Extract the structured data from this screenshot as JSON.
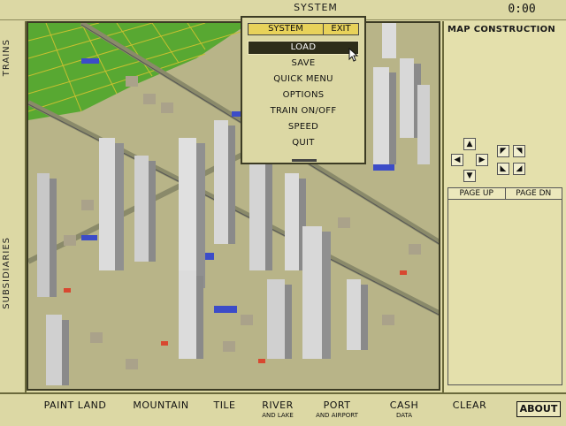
{
  "header": {
    "system_tab": "SYSTEM",
    "clock": "0:00"
  },
  "left_rail": {
    "tabs": [
      "TRAINS",
      "SUBSIDIARIES"
    ]
  },
  "menu": {
    "title": "SYSTEM",
    "exit": "EXIT",
    "items": [
      "LOAD",
      "SAVE",
      "QUICK MENU",
      "OPTIONS",
      "TRAIN ON/OFF",
      "SPEED",
      "QUIT"
    ],
    "selected": "LOAD"
  },
  "right_panel": {
    "title": "MAP CONSTRUCTION",
    "page_up": "PAGE UP",
    "page_down": "PAGE DN",
    "arrow_icons": [
      "arrow-up-icon",
      "arrow-left-icon",
      "arrow-right-icon",
      "arrow-down-icon",
      "diag-up-left-icon",
      "diag-up-right-icon",
      "diag-down-left-icon",
      "diag-down-right-icon"
    ]
  },
  "toolbar": {
    "tools": [
      {
        "label": "PAINT LAND",
        "sub": ""
      },
      {
        "label": "MOUNTAIN",
        "sub": ""
      },
      {
        "label": "TILE",
        "sub": ""
      },
      {
        "label": "RIVER",
        "sub": "AND LAKE"
      },
      {
        "label": "PORT",
        "sub": "AND AIRPORT"
      },
      {
        "label": "CASH",
        "sub": "DATA"
      },
      {
        "label": "CLEAR",
        "sub": ""
      }
    ],
    "about": "ABOUT"
  },
  "colors": {
    "panel_bg": "#dcd8a4",
    "menu_highlight": "#2e2d1a",
    "menu_header": "#e8d25a",
    "grass": "#58a832",
    "city_ground": "#b8b488",
    "building": "#d8d8d8"
  }
}
